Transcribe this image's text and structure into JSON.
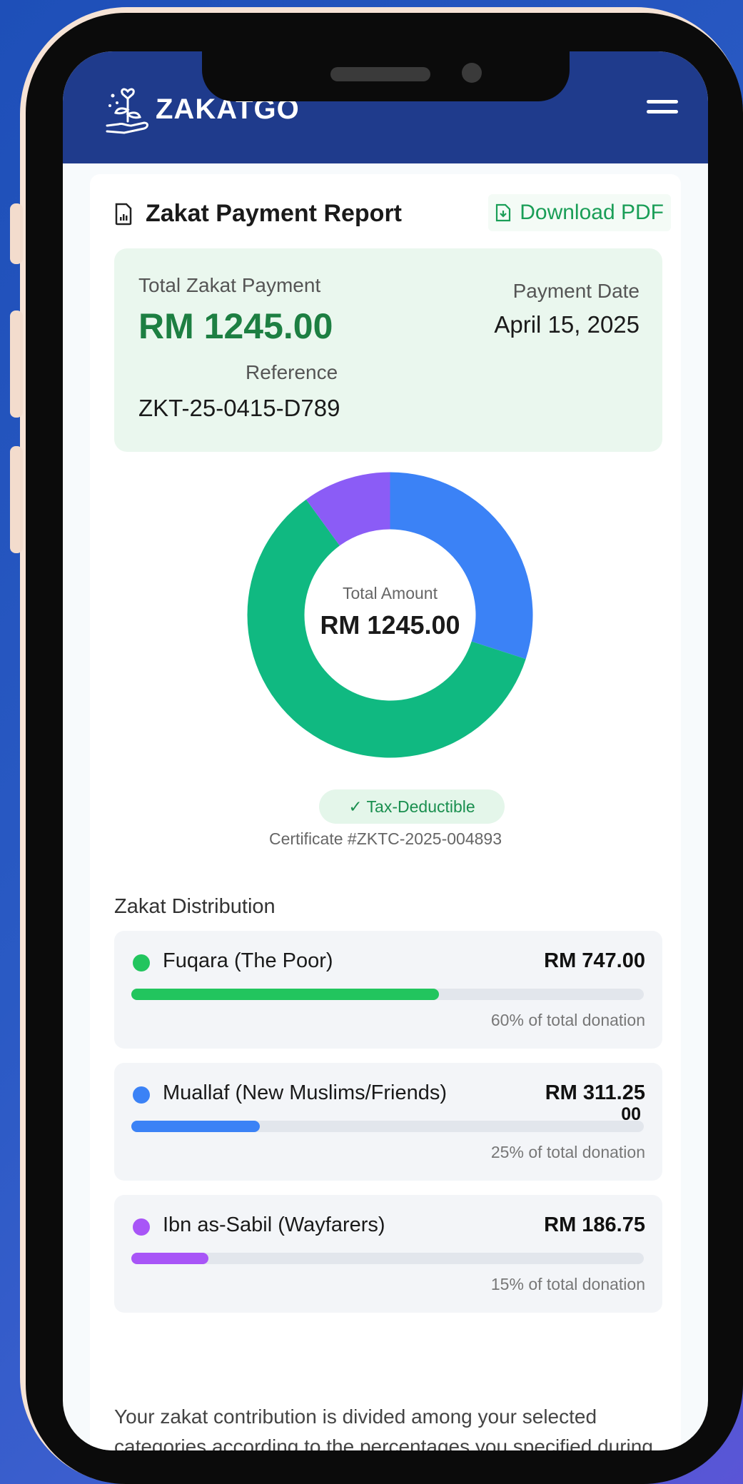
{
  "brand": {
    "name": "ZAKATGO"
  },
  "header": {
    "menu_icon": "hamburger-menu-icon"
  },
  "report": {
    "title": "Zakat Payment Report",
    "download_label": "Download PDF",
    "summary": {
      "total_label": "Total Zakat Payment",
      "total_value": "RM 1245.00",
      "date_label": "Payment Date",
      "date_value": "April 15, 2025",
      "reference_label": "Reference",
      "reference_value": "ZKT-25-0415-D789"
    },
    "donut": {
      "center_label": "Total Amount",
      "center_value": "RM 1245.00"
    },
    "tax": {
      "badge": "✓ Tax-Deductible",
      "certificate": "Certificate #ZKTC-2025-004893"
    },
    "distribution": {
      "heading": "Zakat Distribution",
      "items": [
        {
          "name": "Fuqara (The Poor)",
          "amount": "RM 747.00",
          "percent_text": "60% of total donation",
          "fraction": 0.6,
          "color": "#22c55e"
        },
        {
          "name": "Muallaf (New Muslims/Friends)",
          "amount": "RM 311.25",
          "overflow": "00",
          "percent_text": "25% of total donation",
          "fraction": 0.25,
          "color": "#3b82f6"
        },
        {
          "name": "Ibn as-Sabil (Wayfarers)",
          "amount": "RM 186.75",
          "percent_text": "15% of total donation",
          "fraction": 0.15,
          "color": "#a855f7"
        }
      ]
    },
    "footnote": "Your zakat contribution is divided among your selected categories according to the percentages you specified during donation."
  },
  "chart_data": {
    "type": "pie",
    "categories": [
      "Blue segment",
      "Green segment",
      "Purple segment"
    ],
    "values": [
      30,
      60,
      10
    ],
    "colors": [
      "#3b82f6",
      "#10b981",
      "#8b5cf6"
    ]
  },
  "colors": {
    "header_bg": "#1f3b8c",
    "accent_green": "#1d7f42",
    "summary_bg": "#eaf7ee"
  }
}
